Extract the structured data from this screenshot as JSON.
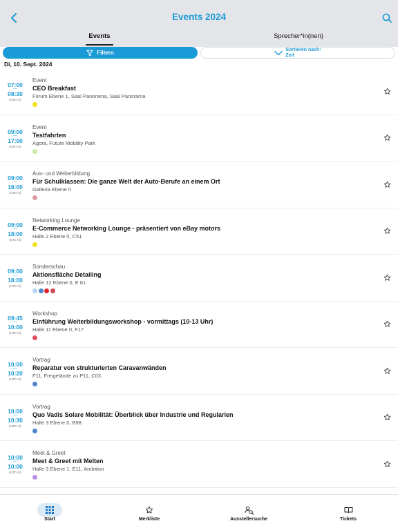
{
  "header": {
    "title": "Events 2024",
    "back_icon": "chevron-left-icon",
    "search_icon": "search-icon",
    "accent_color": "#1a9ad6"
  },
  "tabs": [
    {
      "label": "Events",
      "active": true
    },
    {
      "label": "Sprecher*in(nen)",
      "active": false
    }
  ],
  "controls": {
    "filter_label": "Filtern",
    "sort_label": "Sortieren nach:",
    "sort_value": "Zeit"
  },
  "date_header": "Di, 10. Sept. 2024",
  "events": [
    {
      "start": "07:00",
      "end": "08:30",
      "tz": "(UTC+2)",
      "category": "Event",
      "title": "CEO Breakfast",
      "location": "Forum Ebene 1, Saal Panorama, Saal Panorama",
      "dots": [
        "#f2e21b"
      ]
    },
    {
      "start": "09:00",
      "end": "17:00",
      "tz": "(UTC+2)",
      "category": "Event",
      "title": "Testfahrten",
      "location": "Agora, Future Mobility Park",
      "dots": [
        "#c9eba3"
      ]
    },
    {
      "start": "09:00",
      "end": "18:00",
      "tz": "(UTC+2)",
      "category": "Aus- und Weiterbildung",
      "title": "Für Schulklassen: Die ganze Welt der Auto-Berufe an einem Ort",
      "location": "Galleria Ebene 0",
      "dots": [
        "#d99aa2"
      ]
    },
    {
      "start": "09:00",
      "end": "18:00",
      "tz": "(UTC+2)",
      "category": "Networking Lounge",
      "title": "E-Commerce Networking Lounge - präsentiert von eBay motors",
      "location": "Halle 2 Ebene 0, C51",
      "dots": [
        "#f2e21b"
      ]
    },
    {
      "start": "09:00",
      "end": "18:00",
      "tz": "(UTC+2)",
      "category": "Sonderschau",
      "title": "Aktionsfläche Detailing",
      "location": "Halle 12 Ebene 0, E 81",
      "dots": [
        "#b9d4f1",
        "#4f86cf",
        "#d92631",
        "#c94a55"
      ]
    },
    {
      "start": "09:45",
      "end": "10:00",
      "tz": "(UTC+2)",
      "category": "Workshop",
      "title": "Einführung Weiterbildungsworkshop -  vormittags (10-13 Uhr)",
      "location": "Halle 11 Ebene 0, F17",
      "dots": [
        "#e0505f"
      ]
    },
    {
      "start": "10:00",
      "end": "10:20",
      "tz": "(UTC+2)",
      "category": "Vortrag",
      "title": "Reparatur von strukturierten Caravanwänden",
      "location": "F11, Freigelände zu P11, C03",
      "dots": [
        "#4f86cf"
      ]
    },
    {
      "start": "10:00",
      "end": "10:30",
      "tz": "(UTC+2)",
      "category": "Vortrag",
      "title": "Quo Vadis Solare Mobilität: Überblick über Industrie und Regularien",
      "location": "Halle 3 Ebene 0, B98",
      "dots": [
        "#4f86cf"
      ]
    },
    {
      "start": "10:00",
      "end": "10:00",
      "tz": "(UTC+2)",
      "category": "Meet & Greet",
      "title": "Meet & Greet mit Melten",
      "location": "Halle 3 Ebene 1, E11, Ambition",
      "dots": [
        "#b98ee0"
      ]
    }
  ],
  "star_icon": "star-outline-icon",
  "bottom_nav": [
    {
      "label": "Start",
      "icon": "grid-icon",
      "active": true
    },
    {
      "label": "Merkliste",
      "icon": "star-outline-icon",
      "active": false
    },
    {
      "label": "Ausstellersuche",
      "icon": "exhibitors-icon",
      "active": false
    },
    {
      "label": "Tickets",
      "icon": "ticket-icon",
      "active": false
    }
  ]
}
